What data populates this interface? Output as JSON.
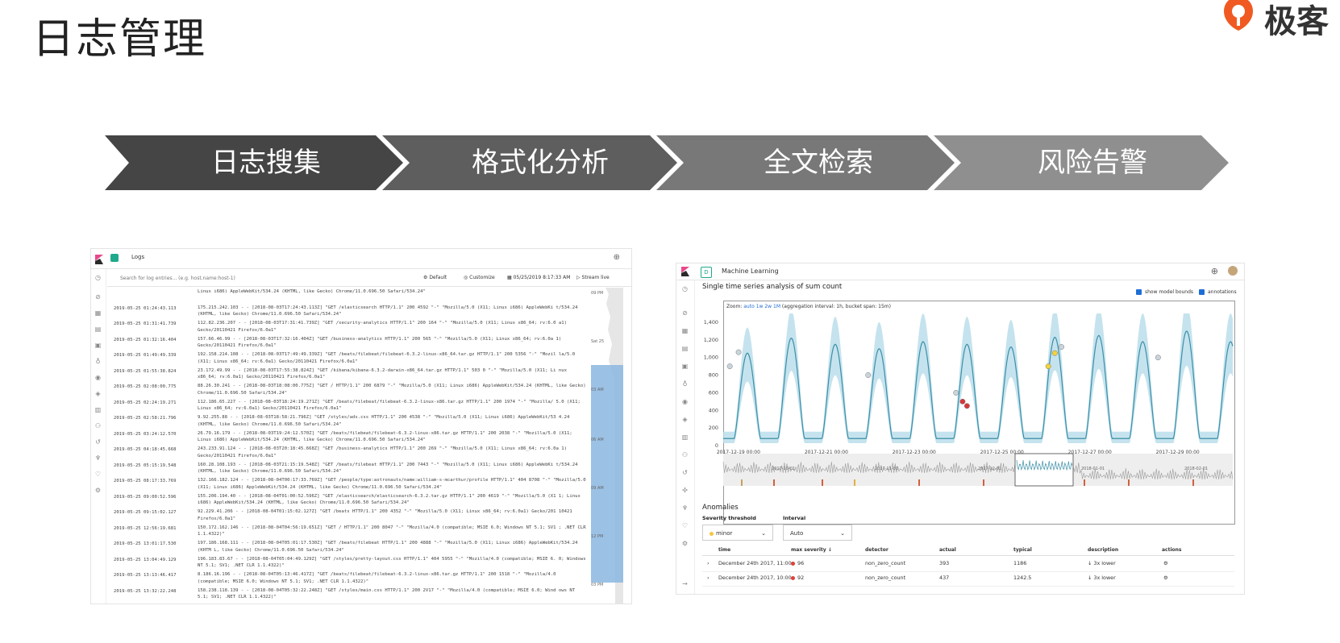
{
  "slide": {
    "title": "日志管理",
    "brand": {
      "name": "极客",
      "color": "#f05a22"
    },
    "steps": [
      "日志搜集",
      "格式化分析",
      "全文检索",
      "风险告警"
    ],
    "step_colors": [
      "#454545",
      "#5e5e5e",
      "#787878",
      "#8f8f8f"
    ]
  },
  "logs_panel": {
    "app_title": "Logs",
    "search_placeholder": "Search for log entries... (e.g. host.name:host-1)",
    "default_label": "Default",
    "customize_label": "Customize",
    "datetime": "05/25/2019 8:17:33 AM",
    "stream_label": "Stream live",
    "minimap_labels": [
      "09 PM",
      "Sat 25",
      "03 AM",
      "06 AM",
      "09 AM",
      "12 PM",
      "03 PM"
    ],
    "rows": [
      {
        "ts": "",
        "msg": "Linux i686) AppleWebKit/534.24 (KHTML, like Gecko) Chrome/11.0.696.50 Safari/534.24\""
      },
      {
        "ts": "2019-05-25 01:24:43.113",
        "msg": "175.215.242.103 - - [2018-08-03T17:24:43.113Z] \"GET /elasticsearch HTTP/1.1\" 200 4592 \"-\" \"Mozilla/5.0 (X11; Linux i686) AppleWebKi t/534.24 (KHTML, like Gecko) Chrome/11.0.696.50 Safari/534.24\""
      },
      {
        "ts": "2019-05-25 01:31:41.739",
        "msg": "112.82.236.207 - - [2018-08-03T17:31:41.739Z] \"GET /security-analytics HTTP/1.1\" 200 164 \"-\" \"Mozilla/5.0 (X11; Linux x86_64; rv:6.0 a1) Gecko/20110421 Firefox/6.0a1\""
      },
      {
        "ts": "2019-05-25 01:32:16.404",
        "msg": "157.66.46.99 - - [2018-08-03T17:32:16.404Z] \"GET /business-analytics HTTP/1.1\" 200 565 \"-\" \"Mozilla/5.0 (X11; Linux x86_64; rv:6.0a 1) Gecko/20110421 Firefox/6.0a1\""
      },
      {
        "ts": "2019-05-25 01:49:49.339",
        "msg": "192.158.214.108 - - [2018-08-03T17:49:49.339Z] \"GET /beats/filebeat/filebeat-6.3.2-linux-x86_64.tar.gz HTTP/1.1\" 200 5356 \"-\" \"Mozil la/5.0 (X11; Linux x86_64; rv:6.0a1) Gecko/20110421 Firefox/6.0a1\""
      },
      {
        "ts": "2019-05-25 01:55:38.824",
        "msg": "23.172.49.99 - - [2018-08-03T17:55:38.824Z] \"GET /kibana/kibana-6.3.2-darwin-x86_64.tar.gz HTTP/1.1\" 503 0 \"-\" \"Mozilla/5.0 (X11; Li nux x86_64; rv:6.0a1) Gecko/20110421 Firefox/6.0a1\""
      },
      {
        "ts": "2019-05-25 02:08:00.775",
        "msg": "88.26.30.241 - - [2018-08-03T18:08:00.775Z] \"GET / HTTP/1.1\" 200 6879 \"-\" \"Mozilla/5.0 (X11; Linux i686) AppleWebKit/534.24 (KHTML, like Gecko) Chrome/11.0.696.50 Safari/534.24\""
      },
      {
        "ts": "2019-05-25 02:24:19.271",
        "msg": "112.186.65.227 - - [2018-08-03T18:24:19.271Z] \"GET /beats/filebeat/filebeat-6.3.2-linux-x86.tar.gz HTTP/1.1\" 200 1974 \"-\" \"Mozilla/ 5.0 (X11; Linux x86_64; rv:6.0a1) Gecko/20110421 Firefox/6.0a1\""
      },
      {
        "ts": "2019-05-25 02:58:21.796",
        "msg": "9.92.255.88 - - [2018-08-03T18:58:21.796Z] \"GET /styles/ads.css HTTP/1.1\" 200 4538 \"-\" \"Mozilla/5.0 (X11; Linux i686) AppleWebKit/53 4.24 (KHTML, like Gecko) Chrome/11.0.696.50 Safari/534.24\""
      },
      {
        "ts": "2019-05-25 03:24:12.570",
        "msg": "26.79.16.179 - - [2018-08-03T19:24:12.570Z] \"GET /beats/filebeat/filebeat-6.3.2-linux-x86.tar.gz HTTP/1.1\" 200 2038 \"-\" \"Mozilla/5.0 (X11; Linux i686) AppleWebKit/534.24 (KHTML, like Gecko) Chrome/11.0.696.50 Safari/534.24\""
      },
      {
        "ts": "2019-05-25 04:18:45.668",
        "msg": "243.233.91.124 - - [2018-08-03T20:18:45.668Z] \"GET /business-analytics HTTP/1.1\" 200 269 \"-\" \"Mozilla/5.0 (X11; Linux x86_64; rv:6.0a 1) Gecko/20110421 Firefox/6.0a1\""
      },
      {
        "ts": "2019-05-25 05:15:19.548",
        "msg": "160.28.108.193 - - [2018-08-03T21:15:19.548Z] \"GET /beats/filebeat HTTP/1.1\" 200 7443 \"-\" \"Mozilla/5.0 (X11; Linux i686) AppleWebKi t/534.24 (KHTML, like Gecko) Chrome/11.0.696.50 Safari/534.24\""
      },
      {
        "ts": "2019-05-25 08:17:33.769",
        "msg": "132.166.182.124 - - [2018-08-04T00:17:33.769Z] \"GET /people/type:astronauts/name:william-s-mcarthur/profile HTTP/1.1\" 404 8708 \"-\" \"Mozilla/5.0 (X11; Linux i686) AppleWebKit/534.24 (KHTML, like Gecko) Chrome/11.0.696.50 Safari/534.24\""
      },
      {
        "ts": "2019-05-25 09:00:52.596",
        "msg": "155.206.194.40 - - [2018-08-04T01:00:52.596Z] \"GET /elasticsearch/elasticsearch-6.3.2.tar.gz HTTP/1.1\" 200 4619 \"-\" \"Mozilla/5.0 (X1 1; Linux i686) AppleWebKit/534.24 (KHTML, like Gecko) Chrome/11.0.696.50 Safari/534.24\""
      },
      {
        "ts": "2019-05-25 09:15:02.127",
        "msg": "92.229.41.206 - - [2018-08-04T01:15:02.127Z] \"GET /beats HTTP/1.1\" 200 4352 \"-\" \"Mozilla/5.0 (X11; Linux x86_64; rv:6.0a1) Gecko/201 10421 Firefox/6.0a1\""
      },
      {
        "ts": "2019-05-25 12:56:19.681",
        "msg": "150.172.162.146 - - [2018-08-04T04:56:19.651Z] \"GET / HTTP/1.1\" 200 8047 \"-\" \"Mozilla/4.0 (compatible; MSIE 6.0; Windows NT 5.1; SV1 ; .NET CLR 1.1.4322)\""
      },
      {
        "ts": "2019-05-25 13:01:17.530",
        "msg": "197.186.168.111 - - [2018-08-04T05:01:17.530Z] \"GET /beats/filebeat HTTP/1.1\" 200 4888 \"-\" \"Mozilla/5.0 (X11; Linux i686) AppleWebKit/534.24 (KHTM L, like Gecko) Chrome/11.0.696.50 Safari/534.24\""
      },
      {
        "ts": "2019-05-25 13:04:49.129",
        "msg": "196.183.83.67 - - [2018-08-04T05:04:49.129Z] \"GET /styles/pretty-layout.css HTTP/1.1\" 404 5955 \"-\" \"Mozilla/4.0 (compatible; MSIE 6. 0; Windows NT 5.1; SV1; .NET CLR 1.1.4322)\""
      },
      {
        "ts": "2019-05-25 13:13:46.417",
        "msg": "8.186.16.196 - - [2018-08-04T05:13:46.417Z] \"GET /beats/filebeat/filebeat-6.3.2-linux-x86.tar.gz HTTP/1.1\" 200 1518 \"-\" \"Mozilla/4.0 (compatible; MSIE 6.0; Windows NT 5.1; SV1; .NET CLR 1.1.4322)\""
      },
      {
        "ts": "2019-05-25 13:32:22.248",
        "msg": "158.238.118.139 - - [2018-08-04T05:32:22.248Z] \"GET /styles/main.css HTTP/1.1\" 200 2V17 \"-\" \"Mozilla/4.0 (compatible; MSIE 6.0; Wind ows NT 5.1; SV1; .NET CLR 1.1.4322)\""
      }
    ]
  },
  "ml_panel": {
    "app_title": "Machine Learning",
    "badge": "D",
    "subtitle": "Single time series analysis of sum count",
    "show_model_bounds": "show model bounds",
    "annotations": "annotations",
    "zoom_prefix": "Zoom:",
    "zoom_links": [
      "auto",
      "1w",
      "2w",
      "1M"
    ],
    "zoom_suffix": "(aggregation interval: 1h, bucket span: 15m)",
    "anomalies_title": "Anomalies",
    "severity_label": "Severity threshold",
    "severity_value": "minor",
    "interval_label": "Interval",
    "interval_value": "Auto",
    "table_headers": [
      "time",
      "max severity ↓",
      "detector",
      "actual",
      "typical",
      "description",
      "actions"
    ],
    "table_rows": [
      {
        "time": "December 24th 2017, 11:00",
        "severity": "96",
        "detector": "non_zero_count",
        "actual": "393",
        "typical": "1186",
        "description": "3x lower"
      },
      {
        "time": "December 24th 2017, 10:00",
        "severity": "92",
        "detector": "non_zero_count",
        "actual": "437",
        "typical": "1242.5",
        "description": "3x lower"
      }
    ],
    "overview_labels": [
      "2017-10-01",
      "2017-11-01",
      "2017-12-01",
      "2018-01-01",
      "2018-02-01"
    ]
  },
  "chart_data": {
    "type": "line",
    "title": "Single time series analysis of sum count",
    "xlabel": "",
    "ylabel": "",
    "ylim": [
      0,
      1500
    ],
    "yticks": [
      0,
      200,
      400,
      600,
      800,
      1000,
      1200,
      1400
    ],
    "xticks": [
      "2017-12-19 00:00",
      "2017-12-21 00:00",
      "2017-12-23 00:00",
      "2017-12-25 00:00",
      "2017-12-27 00:00",
      "2017-12-29 00:00"
    ],
    "xrange_days": [
      0,
      11.6
    ],
    "daily_peaks": [
      1050,
      1220,
      1150,
      1100,
      1180,
      1150,
      1120,
      1230,
      1250,
      1180,
      1300,
      1180
    ],
    "series": [
      {
        "name": "",
        "kind": "actual",
        "color": "#3b8fa6"
      },
      {
        "name": "",
        "kind": "model bounds",
        "color": "#b7dcea"
      }
    ],
    "anomalies": [
      {
        "x": 0.15,
        "y": 900,
        "severity": "low"
      },
      {
        "x": 0.35,
        "y": 1060,
        "severity": "low"
      },
      {
        "x": 3.3,
        "y": 800,
        "severity": "low"
      },
      {
        "x": 5.3,
        "y": 600,
        "severity": "low"
      },
      {
        "x": 5.45,
        "y": 500,
        "severity": "high"
      },
      {
        "x": 5.55,
        "y": 450,
        "severity": "high"
      },
      {
        "x": 7.4,
        "y": 900,
        "severity": "medium"
      },
      {
        "x": 7.55,
        "y": 1050,
        "severity": "medium"
      },
      {
        "x": 7.7,
        "y": 1120,
        "severity": "low"
      },
      {
        "x": 9.9,
        "y": 1000,
        "severity": "low"
      }
    ],
    "grid": false,
    "legend": "none"
  }
}
